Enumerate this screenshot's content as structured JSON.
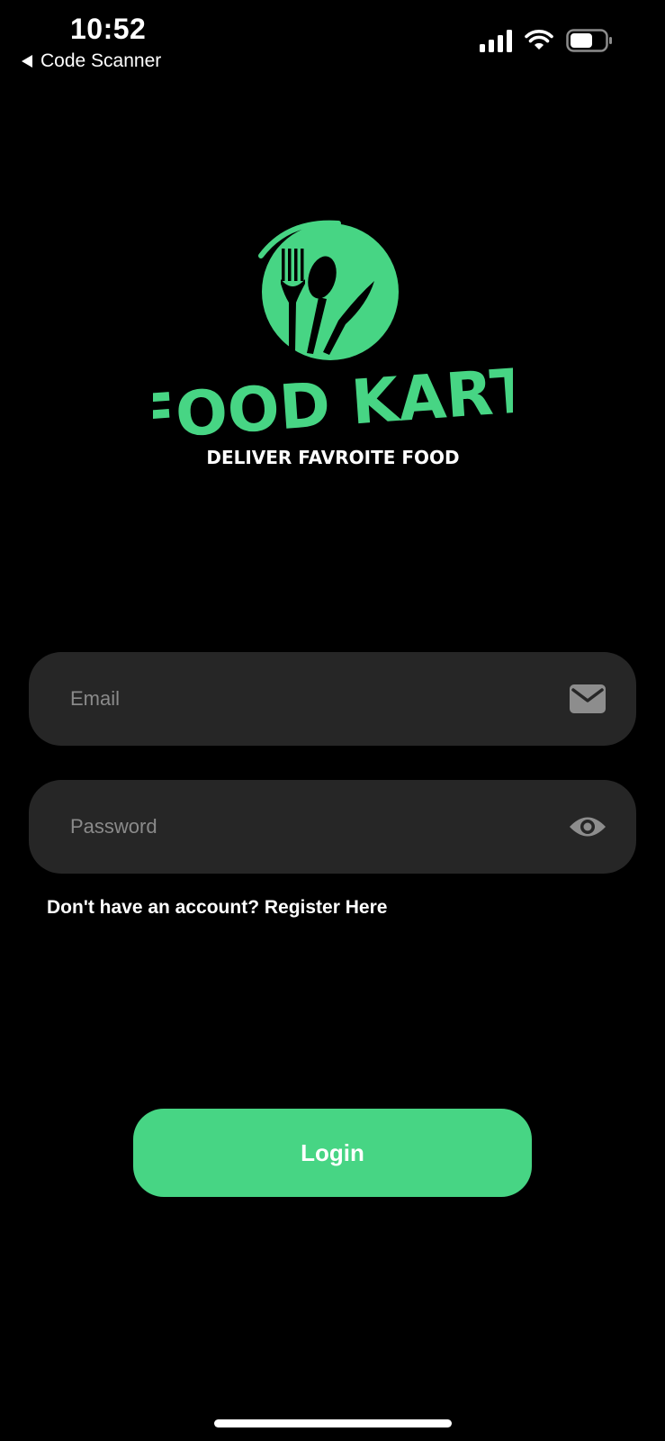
{
  "status_bar": {
    "time": "10:52",
    "back_label": "Code Scanner"
  },
  "brand": {
    "name": "FOOD KART",
    "tagline": "DELIVER FAVROITE FOOD",
    "accent_color": "#47d584"
  },
  "form": {
    "email": {
      "placeholder": "Email",
      "value": "",
      "icon": "mail-icon"
    },
    "password": {
      "placeholder": "Password",
      "value": "",
      "icon": "eye-icon"
    },
    "register_prompt": "Don't have an account? Register Here",
    "login_label": "Login"
  }
}
